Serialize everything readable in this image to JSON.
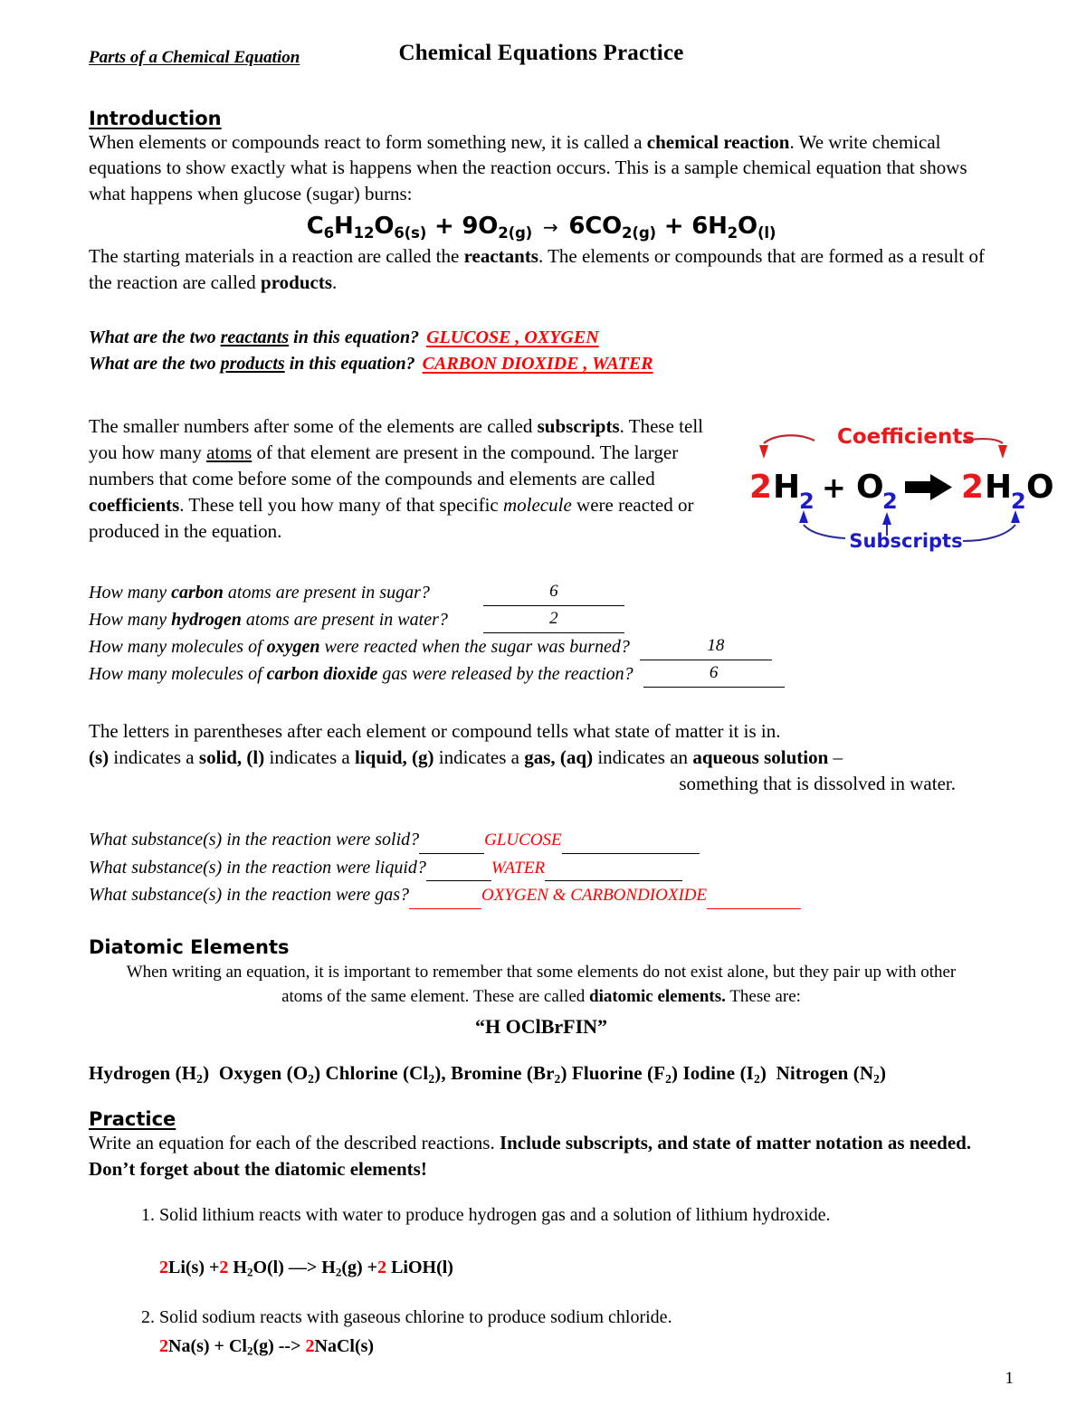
{
  "document": {
    "title": "Chemical Equations  Practice",
    "subtitle": "Parts of a Chemical Equation",
    "page_number": "1"
  },
  "introduction": {
    "heading": "Introduction",
    "para1_a": "When elements or compounds react to form something new, it is called a ",
    "para1_bold1": "chemical reaction",
    "para1_b": ".  We write chemical equations to show exactly what is happens when the reaction occurs.  This is a sample chemical equation that shows what happens when glucose (sugar) burns:",
    "equation": {
      "reactant1": "C6H12O6(s)",
      "plus1": "+",
      "reactant2": "9O2(g)",
      "arrow": "→",
      "product1": "6CO2(g)",
      "plus2": "+",
      "product2": "6H2O(l)"
    },
    "para2_a": "The starting materials in a reaction are called the ",
    "para2_bold1": "reactants",
    "para2_b": ".  The elements or compounds that are formed as a result of the reaction are called ",
    "para2_bold2": "products",
    "para2_c": "."
  },
  "reactant_product_questions": [
    {
      "q_pre": "What are the two ",
      "q_underline": "reactants",
      "q_post": " in this equation?",
      "answer": "GLUCOSE , OXYGEN"
    },
    {
      "q_pre": "What are the two ",
      "q_underline": "products",
      "q_post": " in this equation?",
      "answer": "CARBON DIOXIDE ,    WATER"
    }
  ],
  "subscripts_para": {
    "a": "The smaller numbers after some of the elements are called ",
    "bold1": "subscripts",
    "b": ".  These tell you how many ",
    "underline1": "atoms",
    "c": " of that element are present in the compound.  The larger numbers that come before some of the compounds and elements are called ",
    "bold2": "coefficients",
    "d": ".  These tell you how many of that specific ",
    "italic1": "molecule",
    "e": " were reacted or produced in the equation."
  },
  "diagram": {
    "coefficients_label": "Coefficients",
    "subscripts_label": "Subscripts",
    "coefficient_color": "#E8191C",
    "subscript_color": "#1B1BC8",
    "terms": {
      "coef1": "2",
      "h": "H",
      "h_sub": "2",
      "plus": "+",
      "o": "O",
      "o_sub": "2",
      "coef2": "2",
      "h2": "H",
      "h2_sub": "2",
      "o2": "O"
    }
  },
  "count_questions": [
    {
      "pre": "How many ",
      "bold": "carbon",
      "post": " atoms are present in sugar?",
      "answer": "6",
      "blank1_width": 78,
      "blank2_width": 78
    },
    {
      "pre": "How many ",
      "bold": "hydrogen",
      "post": " atoms are present in water?",
      "answer": "2",
      "blank1_width": 78,
      "blank2_width": 78
    },
    {
      "pre": "How many molecules of ",
      "bold": "oxygen",
      "post": " were reacted when the sugar was burned?",
      "answer": "18",
      "blank1_width": 82,
      "blank2_width": 60
    },
    {
      "pre": "How many molecules of ",
      "bold": "carbon dioxide",
      "post": " gas were released by the reaction?",
      "answer": "6",
      "blank1_width": 78,
      "blank2_width": 78
    }
  ],
  "state_of_matter": {
    "intro": "The letters in parentheses after each element or compound tells what state of matter it is in.",
    "line2": {
      "s": "(s)",
      "s_text": " indicates a ",
      "solid": "solid,",
      "l": " (l)",
      "l_text": " indicates a ",
      "liquid": "liquid,",
      "g": " (g)",
      "g_text": " indicates a ",
      "gas": "gas,",
      "aq": " (aq)",
      "aq_text": " indicates an ",
      "aqueous": "aqueous solution",
      "dash": " –"
    },
    "line3": "something that is dissolved in water."
  },
  "state_questions": [
    {
      "question": "What substance(s) in the reaction were solid?",
      "answer": "GLUCOSE",
      "blank1_width": 70,
      "blank2_width": 150,
      "blank1_red": false,
      "blank2_red": false
    },
    {
      "question": "What substance(s) in the reaction were liquid?",
      "answer": "WATER",
      "blank1_width": 70,
      "blank2_width": 150,
      "blank1_red": false,
      "blank2_red": false
    },
    {
      "question": "What substance(s) in the reaction were gas?",
      "answer": "OXYGEN & CARBONDIOXIDE",
      "blank1_width": 78,
      "blank2_width": 100,
      "blank1_red": true,
      "blank2_red": true
    }
  ],
  "diatomic": {
    "heading": "Diatomic Elements",
    "para_a": "When writing an equation, it is important to remember that some elements do not exist alone, but they pair up with other atoms of the same element.  These are called ",
    "para_bold": "diatomic elements.",
    "para_b": "  These are:",
    "mnemonic": "“H OClBrFIN”",
    "elements": [
      {
        "name": "Hydrogen (H",
        "sub": "2",
        "tail": ")"
      },
      {
        "name": "Oxygen (O",
        "sub": "2",
        "tail": ")"
      },
      {
        "name": "Chlorine (Cl",
        "sub": "2",
        "tail": "),"
      },
      {
        "name": "Bromine (Br",
        "sub": "2",
        "tail": ")"
      },
      {
        "name": "Fluorine (F",
        "sub": "2",
        "tail": ")"
      },
      {
        "name": "Iodine (I",
        "sub": "2",
        "tail": ")"
      },
      {
        "name": "Nitrogen (N",
        "sub": "2",
        "tail": ")"
      }
    ]
  },
  "practice": {
    "heading": "Practice",
    "instructions_a": "Write an equation for each of the described reactions.  ",
    "instructions_bold": "Include subscripts, and state of matter notation as needed.  Don’t forget about the diatomic elements!",
    "items": [
      {
        "prompt": "Solid lithium reacts with water to produce hydrogen gas and a solution of lithium hydroxide.",
        "answer_parts": [
          {
            "text": "2",
            "red": true
          },
          {
            "text": "Li(s) +",
            "red": false
          },
          {
            "text": "2",
            "red": true
          },
          {
            "text": " H₂O(l) —> H₂(g) +",
            "red": false
          },
          {
            "text": "2",
            "red": true
          },
          {
            "text": " LiOH(l)",
            "red": false
          }
        ],
        "spacing": "loose"
      },
      {
        "prompt": "Solid sodium reacts with gaseous chlorine to produce sodium chloride.",
        "answer_parts": [
          {
            "text": "2",
            "red": true
          },
          {
            "text": "Na(s) + Cl₂(g) --> ",
            "red": false
          },
          {
            "text": "2",
            "red": true
          },
          {
            "text": "NaCl(s)",
            "red": false
          }
        ],
        "spacing": "tight"
      }
    ]
  },
  "colors": {
    "answer_red": "#FF0000",
    "text_black": "#000000"
  }
}
